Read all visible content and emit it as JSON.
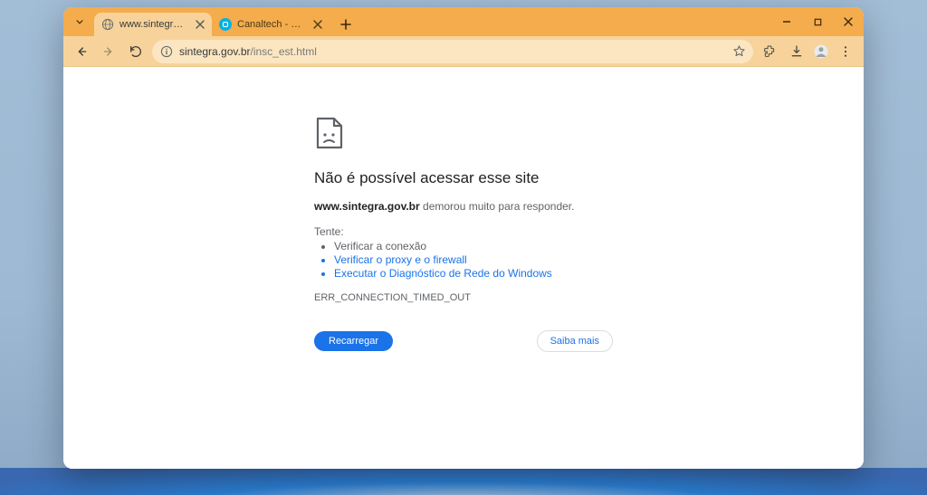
{
  "tabs": [
    {
      "title": "www.sintegra.gov.br",
      "active": true,
      "favicon_bg": "#9aa0a6"
    },
    {
      "title": "Canaltech - Notícias de Tecnol",
      "active": false,
      "favicon_bg": "#00b3e6"
    }
  ],
  "toolbar": {
    "url_host": "sintegra.gov.br",
    "url_path": "/insc_est.html"
  },
  "error": {
    "title": "Não é possível acessar esse site",
    "host_strong": "www.sintegra.gov.br",
    "desc_rest": " demorou muito para responder.",
    "try_label": "Tente:",
    "suggestions": [
      {
        "text": "Verificar a conexão",
        "link": false
      },
      {
        "text": "Verificar o proxy e o firewall",
        "link": true
      },
      {
        "text": "Executar o Diagnóstico de Rede do Windows",
        "link": true
      }
    ],
    "code": "ERR_CONNECTION_TIMED_OUT",
    "reload": "Recarregar",
    "more": "Saiba mais"
  }
}
